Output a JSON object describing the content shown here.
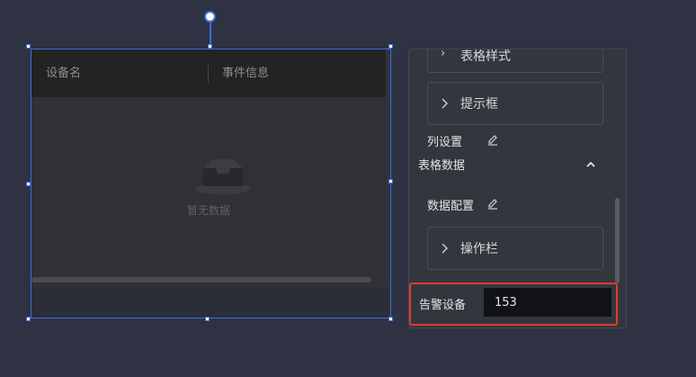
{
  "table": {
    "columns": [
      "设备名",
      "事件信息"
    ],
    "empty_text": "暂无数据"
  },
  "panel": {
    "top_card_label": "表格样式",
    "tip_card_label": "提示框",
    "column_settings_label": "列设置",
    "table_data_label": "表格数据",
    "data_config_label": "数据配置",
    "op_card_label": "操作栏",
    "alarm_label": "告警设备",
    "alarm_value": "153"
  },
  "icons": {
    "chevron": "chevron-right-icon",
    "edit": "edit-icon",
    "collapse": "chevron-up-icon",
    "empty": "empty-inbox-icon"
  },
  "colors": {
    "selection": "#3d6bd8",
    "highlight": "#e23a2c"
  }
}
